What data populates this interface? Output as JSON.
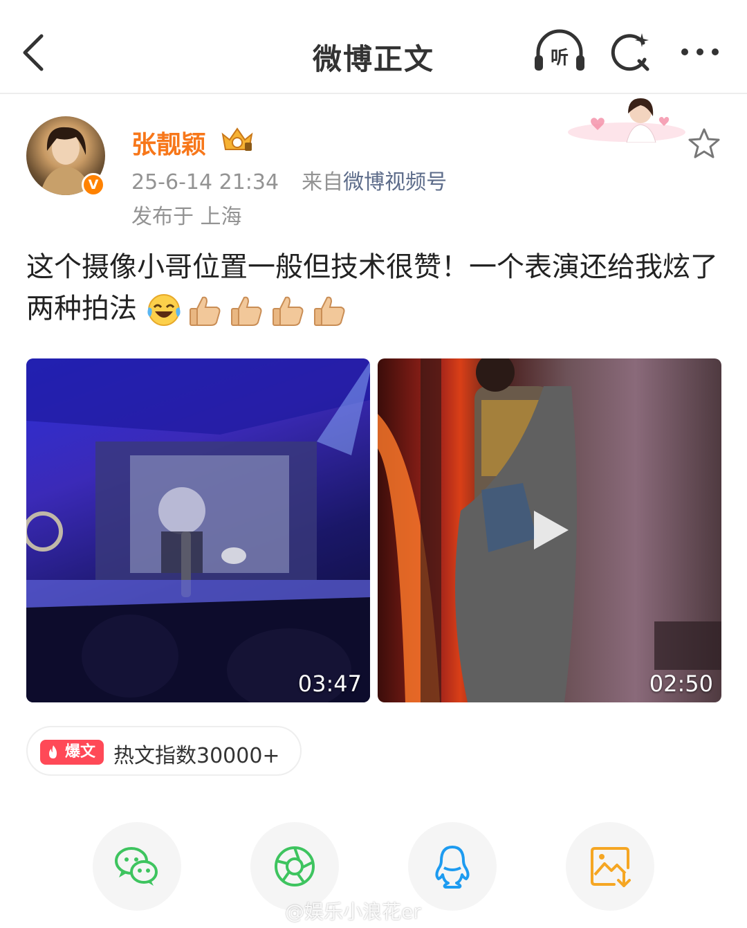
{
  "header": {
    "title": "微博正文",
    "listen_label": "听"
  },
  "post": {
    "author": "张靓颖",
    "verified_mark": "V",
    "timestamp": "25-6-14 21:34",
    "source_prefix": "来自",
    "source": "微博视频号",
    "location": "发布于 上海",
    "text": "这个摄像小哥位置一般但技术很赞！一个表演还给我炫了两种拍法",
    "emojis": [
      "laughing-tears-emoji",
      "thumbs-up-emoji",
      "thumbs-up-emoji",
      "thumbs-up-emoji",
      "thumbs-up-emoji"
    ]
  },
  "videos": [
    {
      "duration": "03:47"
    },
    {
      "duration": "02:50"
    }
  ],
  "hot_badge": {
    "tag": "爆文",
    "text": "热文指数30000+"
  },
  "share": {
    "items": [
      "wechat-icon",
      "moments-icon",
      "qq-icon",
      "save-image-icon"
    ]
  },
  "watermark": "@娱乐小浪花er",
  "colors": {
    "author_orange": "#f7771a",
    "source_link": "#5d6c8a",
    "hot_red": "#ff4957",
    "wechat_green": "#3ec45f",
    "qq_blue": "#1d9bf0",
    "save_orange": "#f5a623"
  }
}
